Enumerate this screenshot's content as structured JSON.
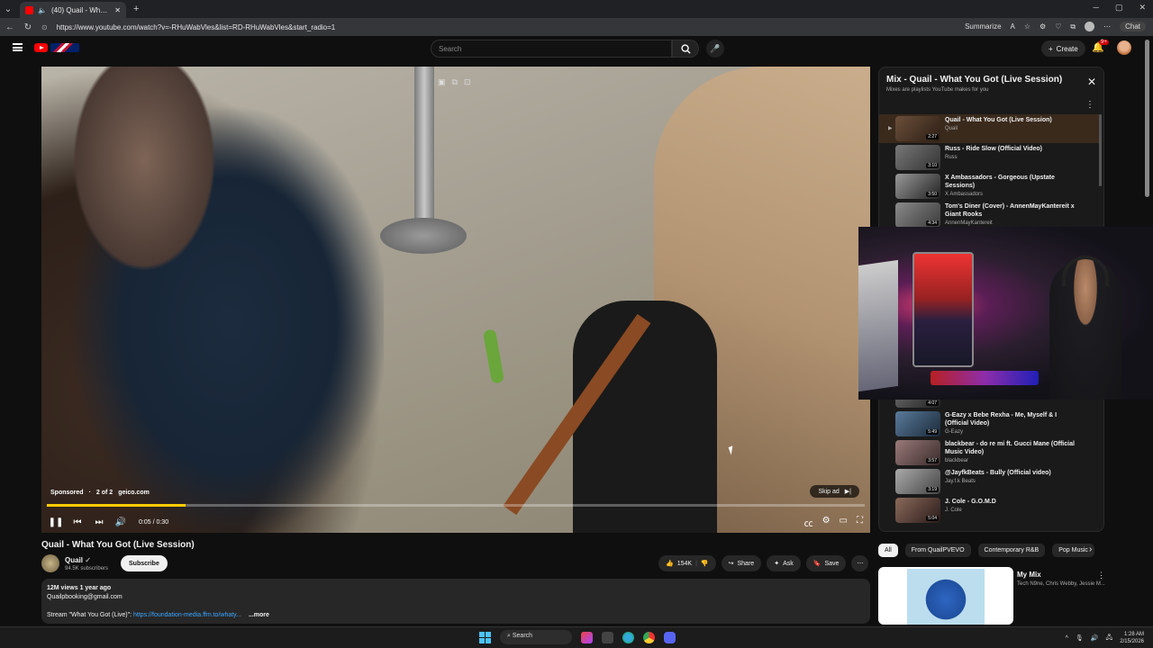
{
  "browser": {
    "tab_title": "(40) Quail - What You Got (Li...",
    "url": "https://www.youtube.com/watch?v=-RHuWabVles&list=RD-RHuWabVles&start_radio=1",
    "summarize_label": "Summarize",
    "chat_label": "Chat"
  },
  "header": {
    "search_placeholder": "Search",
    "create_label": "Create",
    "notif_badge": "9+"
  },
  "player": {
    "sponsored": "Sponsored",
    "ad_position": "2 of 2",
    "advertiser": "geico.com",
    "skip_label": "Skip ad",
    "time": "0:05 / 0:30",
    "progress_fraction": 0.17
  },
  "video": {
    "title": "Quail - What You Got (Live Session)",
    "channel": "Quail",
    "subscribers": "94.5K subscribers",
    "subscribe_label": "Subscribe",
    "likes": "154K",
    "share_label": "Share",
    "ask_label": "Ask",
    "save_label": "Save",
    "views_date": "12M views  1 year ago",
    "email": "Quailpbooking@gmail.com",
    "stream_text": "Stream \"What You Got (Live)\": ",
    "stream_link": "https://foundation-media.ffm.to/whaty...",
    "more_label": "...more"
  },
  "playlist": {
    "title": "Mix - Quail - What You Got (Live Session)",
    "subtitle": "Mixes are playlists YouTube makes for you",
    "items_top": [
      {
        "title": "Quail - What You Got (Live Session)",
        "channel": "Quail",
        "duration": "2:27"
      },
      {
        "title": "Russ - Ride Slow (Official Video)",
        "channel": "Russ",
        "duration": "3:10"
      },
      {
        "title": "X Ambassadors - Gorgeous (Upstate Sessions)",
        "channel": "X Ambassadors",
        "duration": "3:50"
      },
      {
        "title": "Tom's Diner (Cover) - AnnenMayKantereit x Giant Rooks",
        "channel": "AnnenMayKantereit",
        "duration": "4:34"
      }
    ],
    "items_bottom": [
      {
        "title": "",
        "channel": "",
        "duration": "4:07"
      },
      {
        "title": "G-Eazy x Bebe Rexha - Me, Myself & I (Official Video)",
        "channel": "G-Eazy",
        "duration": "5:49"
      },
      {
        "title": "blackbear - do re mi ft. Gucci Mane (Official Music Video)",
        "channel": "blackbear",
        "duration": "3:57"
      },
      {
        "title": "@JayfkBeats - Bully (Official video)",
        "channel": "Jay.f.k Beats",
        "duration": "3:19"
      },
      {
        "title": "J. Cole - G.O.M.D",
        "channel": "J. Cole",
        "duration": "5:04"
      }
    ]
  },
  "chips": [
    "All",
    "From QuailPVEVO",
    "Contemporary R&B",
    "Pop Music"
  ],
  "recommendation": {
    "title": "My Mix",
    "subtitle": "Tech N9ne, Chris Webby, Jessie M..."
  },
  "taskbar": {
    "search_label": "Search",
    "time": "1:28 AM",
    "date": "2/15/2026"
  }
}
